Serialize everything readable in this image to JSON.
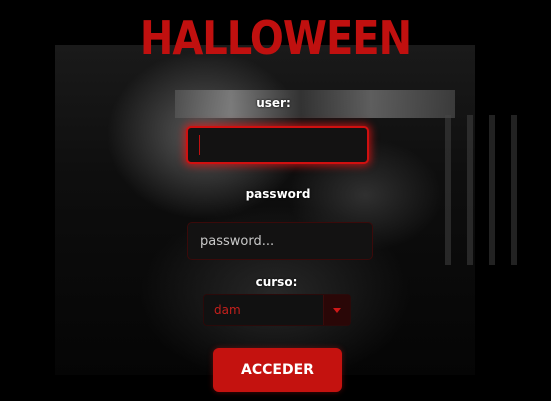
{
  "title": "HALLOWEEN",
  "form": {
    "user_label": "user:",
    "user_value": "",
    "password_label": "password",
    "password_placeholder": "password...",
    "password_value": "",
    "curso_label": "curso:",
    "curso_selected": "dam",
    "submit_label": "ACCEDER"
  },
  "colors": {
    "accent": "#c4120f",
    "title": "#c0100f",
    "background": "#000000"
  },
  "icons": {
    "select_arrow": "chevron-down-icon"
  }
}
